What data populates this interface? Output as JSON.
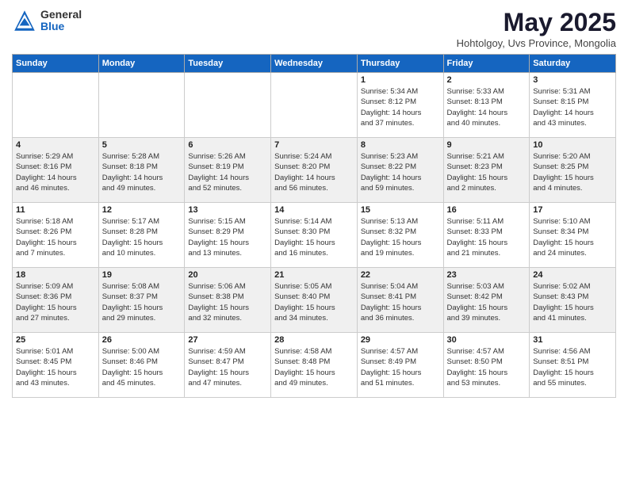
{
  "header": {
    "logo_general": "General",
    "logo_blue": "Blue",
    "title": "May 2025",
    "location": "Hohtolgoy, Uvs Province, Mongolia"
  },
  "weekdays": [
    "Sunday",
    "Monday",
    "Tuesday",
    "Wednesday",
    "Thursday",
    "Friday",
    "Saturday"
  ],
  "weeks": [
    [
      {
        "day": "",
        "info": ""
      },
      {
        "day": "",
        "info": ""
      },
      {
        "day": "",
        "info": ""
      },
      {
        "day": "",
        "info": ""
      },
      {
        "day": "1",
        "info": "Sunrise: 5:34 AM\nSunset: 8:12 PM\nDaylight: 14 hours\nand 37 minutes."
      },
      {
        "day": "2",
        "info": "Sunrise: 5:33 AM\nSunset: 8:13 PM\nDaylight: 14 hours\nand 40 minutes."
      },
      {
        "day": "3",
        "info": "Sunrise: 5:31 AM\nSunset: 8:15 PM\nDaylight: 14 hours\nand 43 minutes."
      }
    ],
    [
      {
        "day": "4",
        "info": "Sunrise: 5:29 AM\nSunset: 8:16 PM\nDaylight: 14 hours\nand 46 minutes."
      },
      {
        "day": "5",
        "info": "Sunrise: 5:28 AM\nSunset: 8:18 PM\nDaylight: 14 hours\nand 49 minutes."
      },
      {
        "day": "6",
        "info": "Sunrise: 5:26 AM\nSunset: 8:19 PM\nDaylight: 14 hours\nand 52 minutes."
      },
      {
        "day": "7",
        "info": "Sunrise: 5:24 AM\nSunset: 8:20 PM\nDaylight: 14 hours\nand 56 minutes."
      },
      {
        "day": "8",
        "info": "Sunrise: 5:23 AM\nSunset: 8:22 PM\nDaylight: 14 hours\nand 59 minutes."
      },
      {
        "day": "9",
        "info": "Sunrise: 5:21 AM\nSunset: 8:23 PM\nDaylight: 15 hours\nand 2 minutes."
      },
      {
        "day": "10",
        "info": "Sunrise: 5:20 AM\nSunset: 8:25 PM\nDaylight: 15 hours\nand 4 minutes."
      }
    ],
    [
      {
        "day": "11",
        "info": "Sunrise: 5:18 AM\nSunset: 8:26 PM\nDaylight: 15 hours\nand 7 minutes."
      },
      {
        "day": "12",
        "info": "Sunrise: 5:17 AM\nSunset: 8:28 PM\nDaylight: 15 hours\nand 10 minutes."
      },
      {
        "day": "13",
        "info": "Sunrise: 5:15 AM\nSunset: 8:29 PM\nDaylight: 15 hours\nand 13 minutes."
      },
      {
        "day": "14",
        "info": "Sunrise: 5:14 AM\nSunset: 8:30 PM\nDaylight: 15 hours\nand 16 minutes."
      },
      {
        "day": "15",
        "info": "Sunrise: 5:13 AM\nSunset: 8:32 PM\nDaylight: 15 hours\nand 19 minutes."
      },
      {
        "day": "16",
        "info": "Sunrise: 5:11 AM\nSunset: 8:33 PM\nDaylight: 15 hours\nand 21 minutes."
      },
      {
        "day": "17",
        "info": "Sunrise: 5:10 AM\nSunset: 8:34 PM\nDaylight: 15 hours\nand 24 minutes."
      }
    ],
    [
      {
        "day": "18",
        "info": "Sunrise: 5:09 AM\nSunset: 8:36 PM\nDaylight: 15 hours\nand 27 minutes."
      },
      {
        "day": "19",
        "info": "Sunrise: 5:08 AM\nSunset: 8:37 PM\nDaylight: 15 hours\nand 29 minutes."
      },
      {
        "day": "20",
        "info": "Sunrise: 5:06 AM\nSunset: 8:38 PM\nDaylight: 15 hours\nand 32 minutes."
      },
      {
        "day": "21",
        "info": "Sunrise: 5:05 AM\nSunset: 8:40 PM\nDaylight: 15 hours\nand 34 minutes."
      },
      {
        "day": "22",
        "info": "Sunrise: 5:04 AM\nSunset: 8:41 PM\nDaylight: 15 hours\nand 36 minutes."
      },
      {
        "day": "23",
        "info": "Sunrise: 5:03 AM\nSunset: 8:42 PM\nDaylight: 15 hours\nand 39 minutes."
      },
      {
        "day": "24",
        "info": "Sunrise: 5:02 AM\nSunset: 8:43 PM\nDaylight: 15 hours\nand 41 minutes."
      }
    ],
    [
      {
        "day": "25",
        "info": "Sunrise: 5:01 AM\nSunset: 8:45 PM\nDaylight: 15 hours\nand 43 minutes."
      },
      {
        "day": "26",
        "info": "Sunrise: 5:00 AM\nSunset: 8:46 PM\nDaylight: 15 hours\nand 45 minutes."
      },
      {
        "day": "27",
        "info": "Sunrise: 4:59 AM\nSunset: 8:47 PM\nDaylight: 15 hours\nand 47 minutes."
      },
      {
        "day": "28",
        "info": "Sunrise: 4:58 AM\nSunset: 8:48 PM\nDaylight: 15 hours\nand 49 minutes."
      },
      {
        "day": "29",
        "info": "Sunrise: 4:57 AM\nSunset: 8:49 PM\nDaylight: 15 hours\nand 51 minutes."
      },
      {
        "day": "30",
        "info": "Sunrise: 4:57 AM\nSunset: 8:50 PM\nDaylight: 15 hours\nand 53 minutes."
      },
      {
        "day": "31",
        "info": "Sunrise: 4:56 AM\nSunset: 8:51 PM\nDaylight: 15 hours\nand 55 minutes."
      }
    ]
  ]
}
